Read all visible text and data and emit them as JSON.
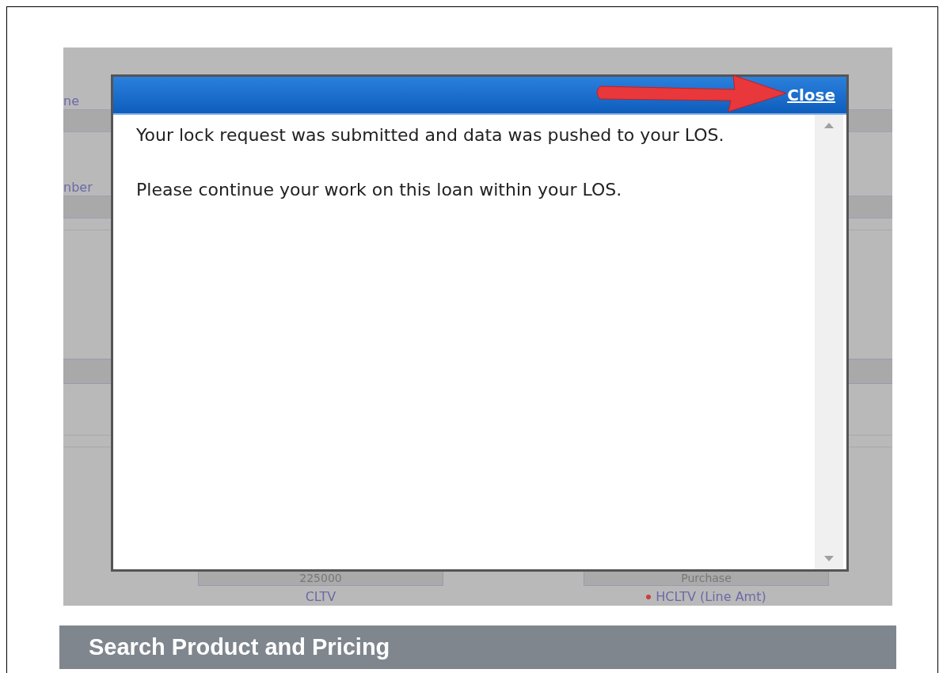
{
  "background_form": {
    "labels": [
      {
        "text": "ne"
      },
      {
        "text": "nber"
      }
    ],
    "fields": [
      {
        "value": "225000"
      },
      {
        "value": "Purchase"
      }
    ],
    "bottom_labels": [
      {
        "text": "CLTV",
        "required": false
      },
      {
        "text": "HCLTV (Line Amt)",
        "required": true
      }
    ]
  },
  "dialog": {
    "close_link": "Close",
    "paragraphs": [
      "Your lock request was submitted and data was pushed to your LOS.",
      "Please continue your work on this loan within your LOS."
    ]
  },
  "section_header": {
    "title": "Search Product and Pricing"
  }
}
